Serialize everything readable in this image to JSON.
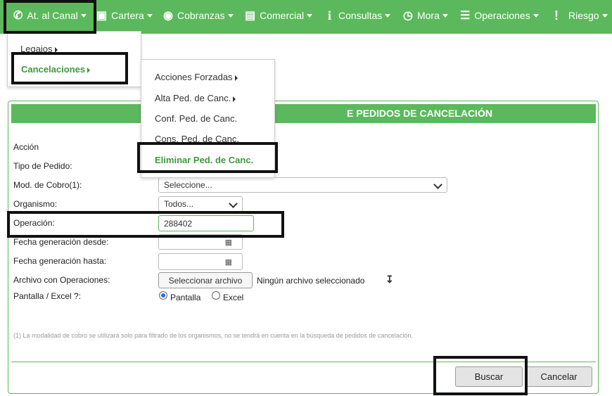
{
  "nav": {
    "items": [
      {
        "label": "At. al Canal",
        "icon": "phone-icon"
      },
      {
        "label": "Cartera",
        "icon": "briefcase-icon"
      },
      {
        "label": "Cobranzas",
        "icon": "money-icon"
      },
      {
        "label": "Comercial",
        "icon": "credit-card-icon"
      },
      {
        "label": "Consultas",
        "icon": "info-icon"
      },
      {
        "label": "Mora",
        "icon": "clock-icon"
      },
      {
        "label": "Operaciones",
        "icon": "list-icon"
      },
      {
        "label": "Riesgo",
        "icon": "exclamation-icon"
      }
    ]
  },
  "menu1": {
    "items": [
      "Legajos",
      "Cancelaciones"
    ]
  },
  "menu2": {
    "items": [
      "Acciones Forzadas",
      "Alta Ped. de Canc.",
      "Conf. Ped. de Canc.",
      "Cons. Ped. de Canc.",
      "Eliminar Ped. de Canc."
    ]
  },
  "panel": {
    "title": "E PEDIDOS DE CANCELACIÓN"
  },
  "form": {
    "accion_label": "Acción",
    "tipo_label": "Tipo de Pedido:",
    "mod_label": "Mod. de Cobro(1):",
    "mod_value": "Seleccione...",
    "organismo_label": "Organismo:",
    "organismo_value": "Todos...",
    "operacion_label": "Operación:",
    "operacion_value": "288402",
    "fecha_desde_label": "Fecha generación desde:",
    "fecha_hasta_label": "Fecha generación hasta:",
    "archivo_label": "Archivo con Operaciones:",
    "archivo_button": "Seleccionar archivo",
    "archivo_status": "Ningún archivo seleccionado",
    "pantalla_label": "Pantalla / Excel ?:",
    "opt_pantalla": "Pantalla",
    "opt_excel": "Excel",
    "footnote": "(1) La modalidad de cobro se utilizará solo para filtrado de los organismos, no se tendrá en cuenta en la búsqueda de pedidos de cancelación."
  },
  "buttons": {
    "buscar": "Buscar",
    "cancelar": "Cancelar"
  },
  "colors": {
    "accent": "#5cb85c"
  }
}
